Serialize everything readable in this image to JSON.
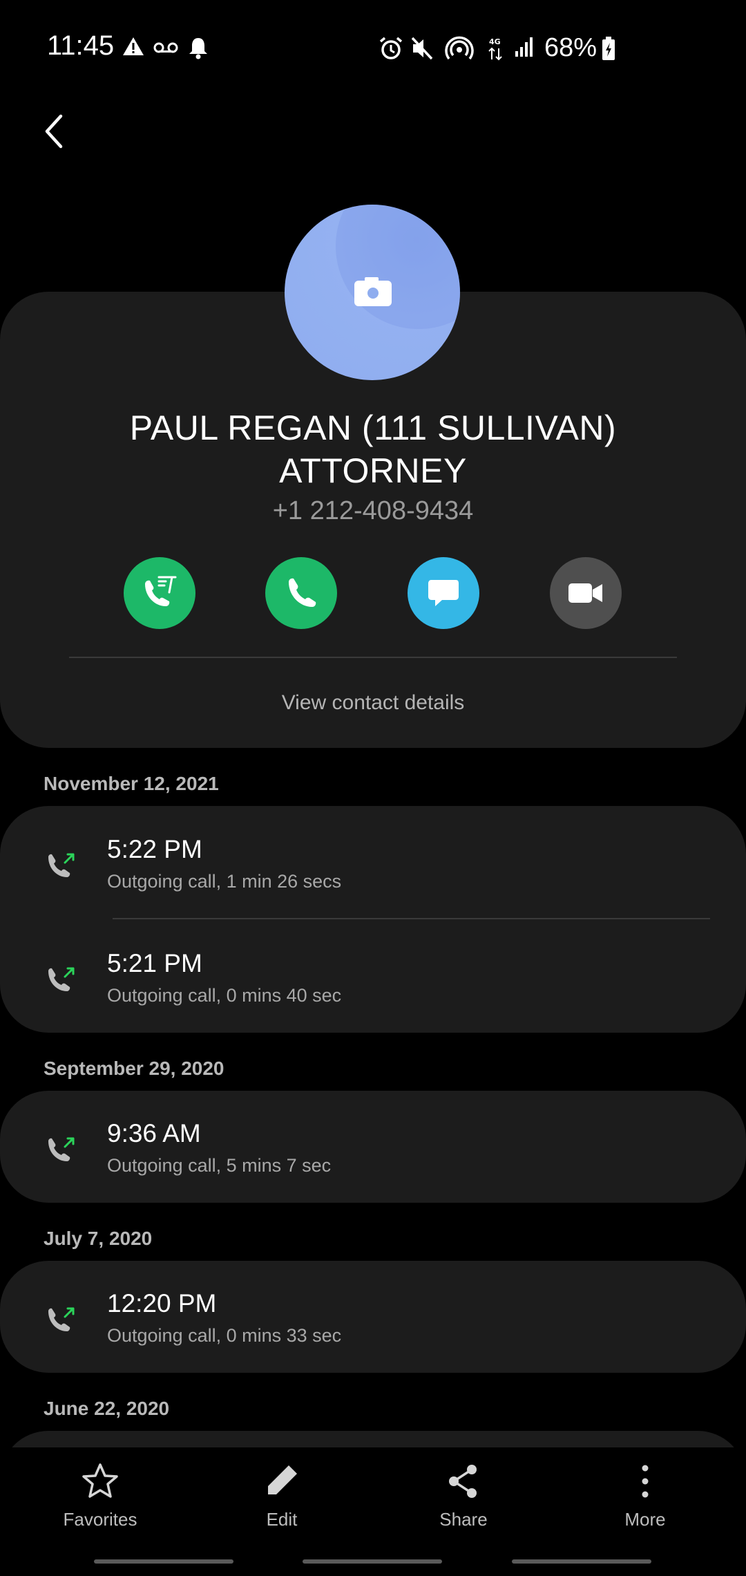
{
  "status_bar": {
    "time": "11:45",
    "battery": "68%"
  },
  "contact": {
    "name_line1": "PAUL REGAN (111 SULLIVAN)",
    "name_line2": "ATTORNEY",
    "phone": "+1 212-408-9434",
    "view_details": "View contact details"
  },
  "actions": [
    {
      "icon": "rtt-call-icon",
      "color": "#1db868"
    },
    {
      "icon": "phone-icon",
      "color": "#1db868"
    },
    {
      "icon": "message-icon",
      "color": "#34b7e6"
    },
    {
      "icon": "video-icon",
      "color": "#4f4f4f"
    }
  ],
  "history": {
    "groups": [
      {
        "date": "November 12, 2021",
        "calls": [
          {
            "time": "5:22 PM",
            "detail": "Outgoing call, 1 min 26 secs"
          },
          {
            "time": "5:21 PM",
            "detail": "Outgoing call, 0 mins 40 sec"
          }
        ]
      },
      {
        "date": "September 29, 2020",
        "calls": [
          {
            "time": "9:36 AM",
            "detail": "Outgoing call, 5 mins 7 sec"
          }
        ]
      },
      {
        "date": "July 7, 2020",
        "calls": [
          {
            "time": "12:20 PM",
            "detail": "Outgoing call, 0 mins 33 sec"
          }
        ]
      },
      {
        "date": "June 22, 2020",
        "calls": []
      }
    ]
  },
  "bottom_nav": [
    {
      "label": "Favorites",
      "icon": "star-icon"
    },
    {
      "label": "Edit",
      "icon": "pencil-icon"
    },
    {
      "label": "Share",
      "icon": "share-icon"
    },
    {
      "label": "More",
      "icon": "more-vertical-icon"
    }
  ],
  "colors": {
    "background": "#000000",
    "card": "#1c1c1c",
    "call_green": "#1db868",
    "message_blue": "#34b7e6",
    "outgoing_arrow": "#2bd35a"
  }
}
